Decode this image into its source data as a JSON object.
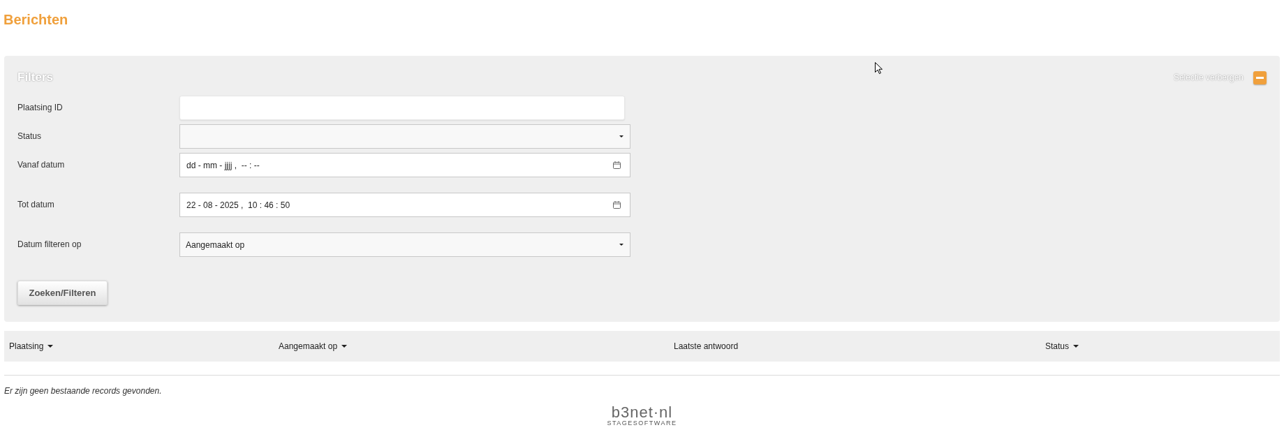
{
  "page": {
    "title": "Berichten"
  },
  "filters": {
    "title": "Filters",
    "toggle_label": "Selectie verbergen",
    "expanded": true,
    "fields": [
      {
        "label": "Plaatsing ID",
        "kind": "text"
      },
      {
        "label": "Status",
        "kind": "select"
      },
      {
        "label": "Vanaf datum",
        "kind": "datetime",
        "placeholder": "dd - mm - jjjj ,  -- : --"
      },
      {
        "label": "Tot datum",
        "kind": "datetime",
        "value": "22 - 08 - 2025 ,  10 : 46 : 50"
      },
      {
        "label": "Datum filteren op",
        "kind": "select",
        "value": "Aangemaakt op"
      }
    ],
    "submit_button": "Zoeken/Filteren"
  },
  "table": {
    "columns": [
      {
        "label": "Plaatsing",
        "sortable": true
      },
      {
        "label": "Aangemaakt op",
        "sortable": true
      },
      {
        "label": "Laatste antwoord",
        "sortable": false
      },
      {
        "label": "Status",
        "sortable": true
      }
    ],
    "empty_message": "Er zijn geen bestaande records gevonden."
  },
  "footer": {
    "logo_name": "b3net·nl",
    "logo_tagline": "STAGESOFTWARE"
  }
}
